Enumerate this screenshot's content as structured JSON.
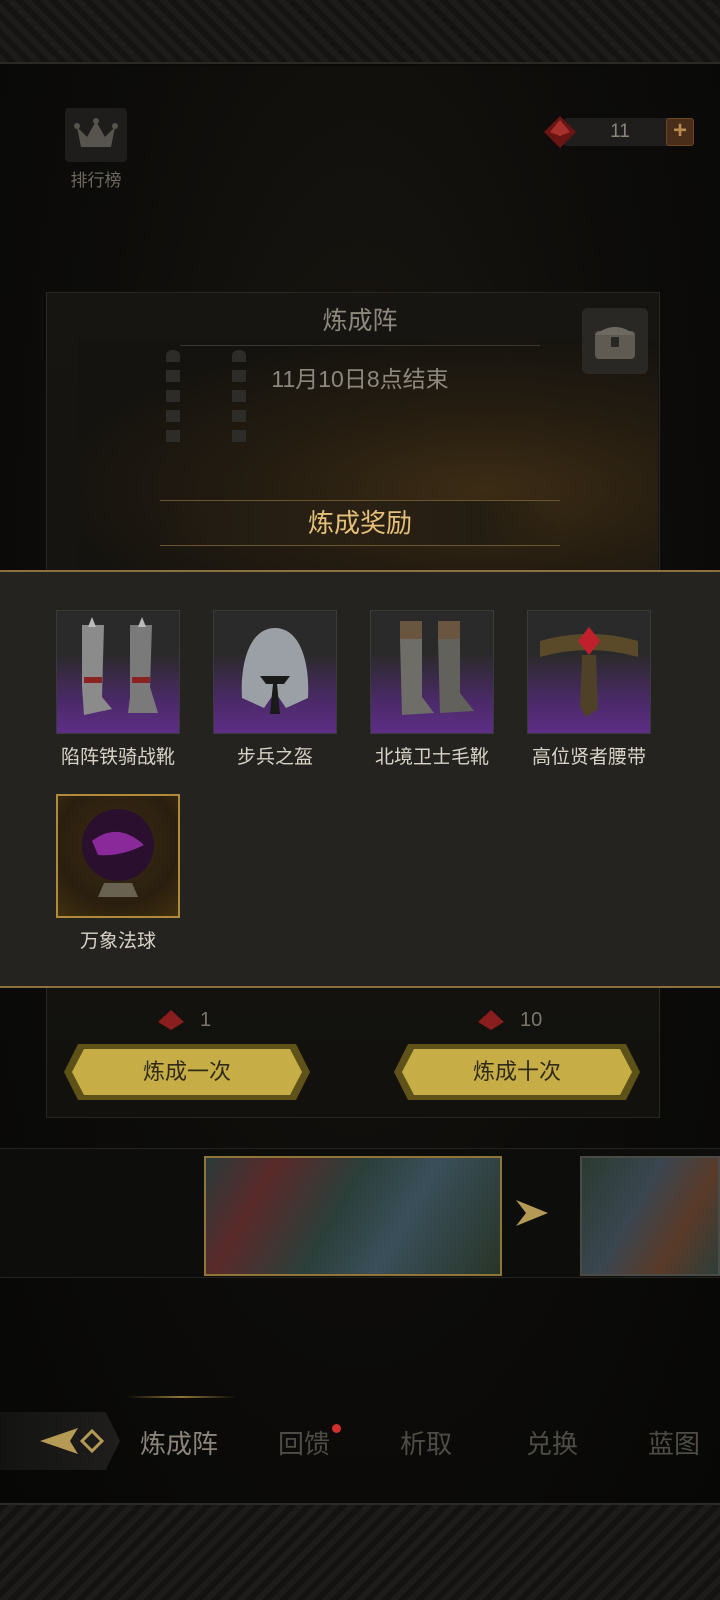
{
  "header": {
    "ranking_label": "排行榜",
    "currency_value": "11"
  },
  "panel": {
    "title": "炼成阵",
    "end_time": "11月10日8点结束",
    "reward_title": "炼成奖励"
  },
  "rewards": [
    {
      "name": "陷阵铁骑战靴",
      "icon": "greaves-icon",
      "rarity": "purple"
    },
    {
      "name": "步兵之盔",
      "icon": "helmet-icon",
      "rarity": "purple"
    },
    {
      "name": "北境卫士毛靴",
      "icon": "boots-icon",
      "rarity": "purple"
    },
    {
      "name": "高位贤者腰带",
      "icon": "belt-icon",
      "rarity": "purple"
    },
    {
      "name": "万象法球",
      "icon": "orb-icon",
      "rarity": "gold"
    }
  ],
  "actions": {
    "single": {
      "cost": "1",
      "label": "炼成一次"
    },
    "ten": {
      "cost": "10",
      "label": "炼成十次"
    }
  },
  "tabs": [
    {
      "label": "炼成阵",
      "active": true
    },
    {
      "label": "回馈",
      "badge": true
    },
    {
      "label": "析取"
    },
    {
      "label": "兑换"
    },
    {
      "label": "蓝图"
    }
  ],
  "colors": {
    "gold_accent": "#e6c07a",
    "purple_rarity": "#5e2e86",
    "button_gold": "#c7ad45",
    "badge_red": "#d2302c"
  }
}
